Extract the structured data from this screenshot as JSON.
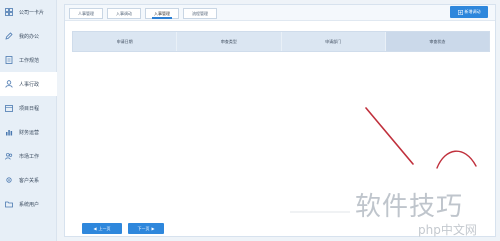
{
  "sidebar": {
    "items": [
      {
        "label": "公司一卡片",
        "icon": "grid-icon"
      },
      {
        "label": "我的办公",
        "icon": "edit-icon"
      },
      {
        "label": "工作规范",
        "icon": "document-icon"
      },
      {
        "label": "人事行政",
        "icon": "user-icon"
      },
      {
        "label": "项目日程",
        "icon": "calendar-icon"
      },
      {
        "label": "财务运营",
        "icon": "chart-icon"
      },
      {
        "label": "市场工作",
        "icon": "people-icon"
      },
      {
        "label": "客户关系",
        "icon": "gear-icon"
      },
      {
        "label": "系统用户",
        "icon": "folder-icon"
      }
    ]
  },
  "tabs": [
    {
      "label": "人事管理"
    },
    {
      "label": "入事调动"
    },
    {
      "label": "入事管理"
    },
    {
      "label": "流程管理"
    }
  ],
  "toolbar": {
    "new_label": "新增调动"
  },
  "table": {
    "headers": [
      "申请日期",
      "审查类型",
      "申请部门",
      "审查状态"
    ]
  },
  "pager": {
    "prev_label": "上一页",
    "next_label": "下一页"
  },
  "watermark": {
    "text": "软件技巧",
    "brand": "php中文网"
  },
  "colors": {
    "accent": "#2e87dc",
    "annotation": "#c0303c"
  }
}
